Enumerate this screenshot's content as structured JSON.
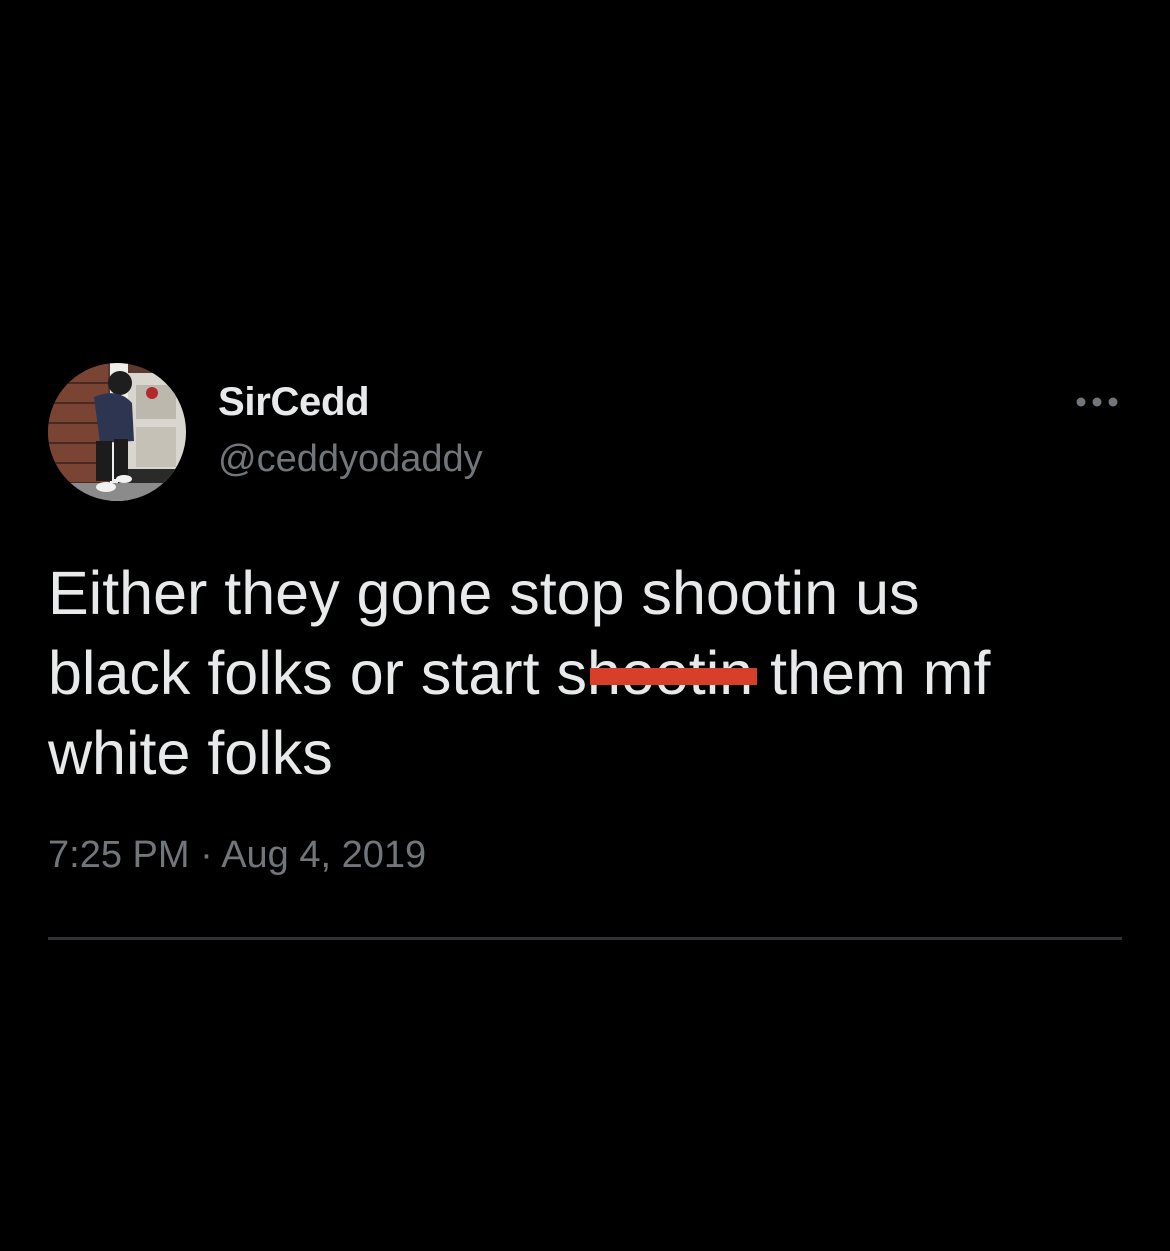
{
  "user": {
    "display_name": "SirCedd",
    "handle": "@ceddyodaddy"
  },
  "tweet": {
    "line1": "Either they gone stop shootin us",
    "line2_before": "black folks or start ",
    "line2_redacted": "shootin",
    "line2_after": " them mf",
    "line3": "white folks",
    "timestamp": "7:25 PM · Aug 4, 2019"
  },
  "icons": {
    "more": "more-horizontal-icon"
  },
  "colors": {
    "background": "#000000",
    "primary_text": "#e7e9ea",
    "secondary_text": "#71767b",
    "redaction": "#d6402b",
    "divider": "#2f3336"
  }
}
